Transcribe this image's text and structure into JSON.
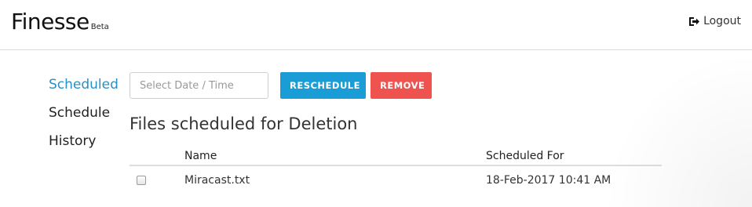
{
  "header": {
    "brand": "Finesse",
    "brand_sub": "Beta",
    "logout_label": "Logout",
    "logout_icon": "sign-out-icon"
  },
  "sidebar": {
    "items": [
      {
        "label": "Scheduled",
        "active": true
      },
      {
        "label": "Schedule",
        "active": false
      },
      {
        "label": "History",
        "active": false
      }
    ]
  },
  "toolbar": {
    "date_placeholder": "Select Date / Time",
    "reschedule_label": "RESCHEDULE",
    "remove_label": "REMOVE"
  },
  "main": {
    "title": "Files scheduled for Deletion",
    "columns": [
      "Name",
      "Scheduled For"
    ],
    "rows": [
      {
        "checked": false,
        "name": "Miracast.txt",
        "scheduled_for": "18-Feb-2017 10:41 AM"
      }
    ]
  },
  "colors": {
    "accent": "#2a8fc4",
    "reschedule": "#1a9dd6",
    "remove": "#ef5350"
  }
}
